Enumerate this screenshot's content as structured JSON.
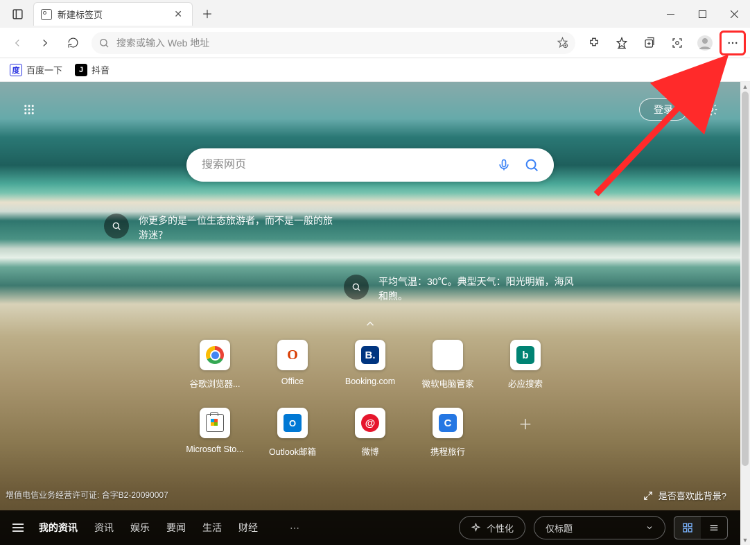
{
  "tab": {
    "title": "新建标签页"
  },
  "address": {
    "placeholder": "搜索或输入 Web 地址"
  },
  "bookmarks": [
    {
      "label": "百度一下",
      "iconClass": "baidu",
      "glyph": "度"
    },
    {
      "label": "抖音",
      "iconClass": "douyin",
      "glyph": "J"
    }
  ],
  "ntp": {
    "login": "登录",
    "search_placeholder": "搜索网页",
    "bubbles": {
      "one": "你更多的是一位生态旅游者，而不是一般的旅游迷？",
      "two": "平均气温：30℃。典型天气：阳光明媚，海风和煦。"
    },
    "tiles": [
      {
        "label": "谷歌浏览器...",
        "icon": "chrome"
      },
      {
        "label": "Office",
        "icon": "office"
      },
      {
        "label": "Booking.com",
        "icon": "booking",
        "glyph": "B."
      },
      {
        "label": "微软电脑管家",
        "icon": "pcmgr"
      },
      {
        "label": "必应搜索",
        "icon": "bing",
        "glyph": "b"
      },
      {
        "label": "Microsoft Sto...",
        "icon": "msstore"
      },
      {
        "label": "Outlook邮箱",
        "icon": "outlook"
      },
      {
        "label": "微博",
        "icon": "weibo",
        "glyph": "@"
      },
      {
        "label": "携程旅行",
        "icon": "ctrip",
        "glyph": "C"
      }
    ],
    "license": "增值电信业务经营许可证: 合字B2-20090007",
    "bg_like": "是否喜欢此背景?"
  },
  "newsbar": {
    "items": [
      "我的资讯",
      "资讯",
      "娱乐",
      "要闻",
      "生活",
      "财经"
    ],
    "active_index": 0,
    "personalize": "个性化",
    "layout_selected": "仅标题"
  }
}
